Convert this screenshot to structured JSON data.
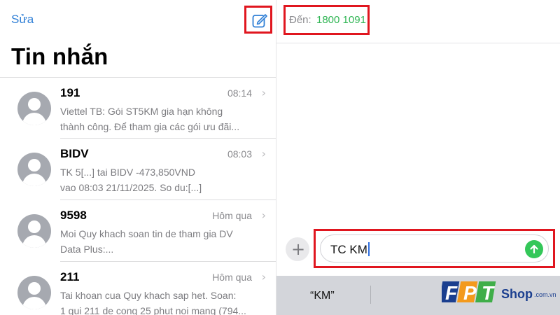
{
  "left_pane": {
    "edit_label": "Sửa",
    "title": "Tin nhắn",
    "conversations": [
      {
        "sender": "191",
        "time": "08:14",
        "preview_line1": "Viettel TB: Gói ST5KM gia hạn không",
        "preview_line2": "thành công. Để tham gia các gói ưu đãi..."
      },
      {
        "sender": "BIDV",
        "time": "08:03",
        "preview_line1": "TK 5[...] tai BIDV -473,850VND",
        "preview_line2": "vao 08:03 21/11/2025. So du:[...]"
      },
      {
        "sender": "9598",
        "time": "Hôm qua",
        "preview_line1": "Moi Quy khach soan tin de tham gia DV",
        "preview_line2": "Data Plus:..."
      },
      {
        "sender": "211",
        "time": "Hôm qua",
        "preview_line1": "Tai khoan cua Quy khach sap het. Soan:",
        "preview_line2": "1 gui 211 de cong 25 phut noi mang (794..."
      }
    ]
  },
  "right_pane": {
    "to_label": "Đến:",
    "to_number": "1800 1091",
    "message_input_value": "TC KM",
    "predictive_suggestion": "“KM”"
  },
  "logo": {
    "letters": [
      "F",
      "P",
      "T"
    ],
    "shop_text": "Shop",
    "domain_text": ".com.vn"
  },
  "colors": {
    "accent_blue": "#2f7fd6",
    "highlight_red": "#e0161f",
    "number_green": "#2fb553",
    "send_green": "#34c759",
    "logo_blue": "#1b3f8f",
    "logo_orange": "#f39a1d",
    "logo_green": "#3fae49"
  },
  "icons": {
    "compose": "compose-icon",
    "chevron": "chevron-right-icon",
    "plus": "plus-icon",
    "send": "send-arrow-up-icon"
  }
}
